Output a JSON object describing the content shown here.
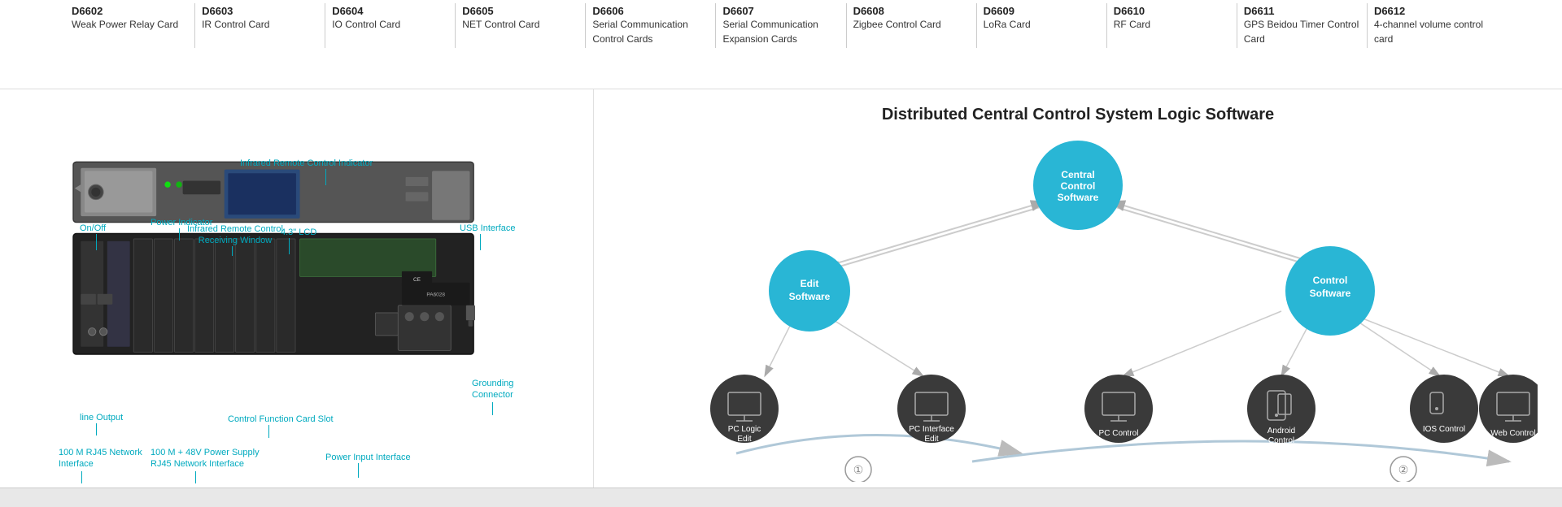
{
  "topSection": {
    "products": [
      {
        "code": "D6602",
        "name": "Weak Power Relay Card"
      },
      {
        "code": "D6603",
        "name": "IR Control Card"
      },
      {
        "code": "D6604",
        "name": "IO Control Card"
      },
      {
        "code": "D6605",
        "name": "NET Control Card"
      },
      {
        "code": "D6606",
        "name": "Serial Communication Control Cards"
      },
      {
        "code": "D6607",
        "name": "Serial Communication Expansion Cards"
      },
      {
        "code": "D6608",
        "name": "Zigbee Control Card"
      },
      {
        "code": "D6609",
        "name": "LoRa Card"
      },
      {
        "code": "D6610",
        "name": "RF Card"
      },
      {
        "code": "D6611",
        "name": "GPS Beidou Timer Control Card"
      },
      {
        "code": "D6612",
        "name": "4-channel volume control card"
      }
    ]
  },
  "leftDiagram": {
    "labels": [
      {
        "id": "infrared-indicator",
        "text": "Infrared Remote Control Indicator"
      },
      {
        "id": "on-off",
        "text": "On/Off"
      },
      {
        "id": "power-indicator",
        "text": "Power Indicator"
      },
      {
        "id": "ir-receiving",
        "text": "Infrared Remote Control\nReceiving Window"
      },
      {
        "id": "lcd",
        "text": "4.3\" LCD"
      },
      {
        "id": "usb",
        "text": "USB Interface"
      },
      {
        "id": "grounding",
        "text": "Grounding\nConnector"
      },
      {
        "id": "control-slot",
        "text": "Control Function Card Slot"
      },
      {
        "id": "line-output",
        "text": "line Output"
      },
      {
        "id": "rj45",
        "text": "100 M RJ45 Network\nInterface"
      },
      {
        "id": "power-rj45",
        "text": "100 M + 48V Power Supply\nRJ45 Network Interface"
      },
      {
        "id": "power-input",
        "text": "Power Input Interface"
      }
    ]
  },
  "rightDiagram": {
    "title": "Distributed Central Control System Logic Software",
    "nodes": [
      {
        "id": "central",
        "label": "Central\nControl\nSoftware",
        "type": "blue",
        "size": 90
      },
      {
        "id": "edit",
        "label": "Edit Software",
        "type": "blue",
        "size": 80
      },
      {
        "id": "control",
        "label": "Control\nSoftware",
        "type": "blue",
        "size": 90
      },
      {
        "id": "pc-logic",
        "label": "PC Logic\nEdit",
        "type": "dark",
        "size": 70
      },
      {
        "id": "pc-interface",
        "label": "PC Interface\nEdit",
        "type": "dark",
        "size": 70
      },
      {
        "id": "pc-control",
        "label": "PC Control",
        "type": "dark",
        "size": 70
      },
      {
        "id": "android",
        "label": "Android\nControl",
        "type": "dark",
        "size": 70
      },
      {
        "id": "ios",
        "label": "IOS Control",
        "type": "dark",
        "size": 70
      },
      {
        "id": "web",
        "label": "Web Control",
        "type": "dark",
        "size": 70
      }
    ],
    "circleLabels": [
      "①",
      "②"
    ]
  }
}
